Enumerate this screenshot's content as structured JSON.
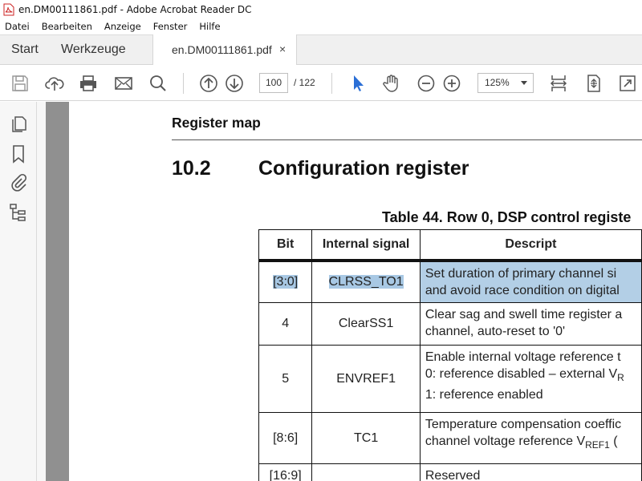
{
  "window": {
    "title": "en.DM00111861.pdf - Adobe Acrobat Reader DC"
  },
  "menu": [
    "Datei",
    "Bearbeiten",
    "Anzeige",
    "Fenster",
    "Hilfe"
  ],
  "tabs": {
    "start": "Start",
    "tools": "Werkzeuge",
    "document": "en.DM00111861.pdf",
    "close": "×"
  },
  "toolbar": {
    "page_current": "100",
    "page_total": "/  122",
    "zoom": "125%",
    "icons": [
      "save-icon",
      "upload-icon",
      "print-icon",
      "mail-icon",
      "search-icon",
      "page-up-icon",
      "page-down-icon",
      "select-cursor-icon",
      "hand-tool-icon",
      "zoom-out-icon",
      "zoom-in-icon",
      "fit-width-icon",
      "fit-page-icon",
      "fullscreen-icon"
    ]
  },
  "left_pane": {
    "icons": [
      "pages-icon",
      "bookmark-icon",
      "attachment-icon",
      "layers-icon"
    ]
  },
  "document": {
    "header": "Register map",
    "section_number": "10.2",
    "section_title": "Configuration register",
    "table_caption": "Table 44. Row 0, DSP control registe",
    "table": {
      "headers": [
        "Bit",
        "Internal signal",
        "Descript"
      ],
      "rows": [
        {
          "bit": "[3:0]",
          "signal": "CLRSS_TO1",
          "desc": [
            "Set duration of primary channel si",
            "and avoid race condition on digital"
          ],
          "highlighted": true
        },
        {
          "bit": "4",
          "signal": "ClearSS1",
          "desc": [
            "Clear sag and swell time register a",
            "channel, auto-reset to '0'"
          ],
          "highlighted": false
        },
        {
          "bit": "5",
          "signal": "ENVREF1",
          "desc": [
            "Enable internal voltage reference t",
            "0: reference disabled – external V",
            "1: reference enabled"
          ],
          "desc_subscript": "R",
          "highlighted": false
        },
        {
          "bit": "[8:6]",
          "signal": "TC1",
          "desc": [
            "Temperature compensation coeffic",
            "channel voltage reference V"
          ],
          "desc_subscript": "REF1",
          "desc_suffix": " (",
          "highlighted": false
        },
        {
          "bit": "[16:9]",
          "signal": "",
          "desc": [
            "Reserved"
          ],
          "highlighted": false
        }
      ]
    }
  },
  "colors": {
    "highlight": "#a8c8e4",
    "accent": "#2b6fd6",
    "scroll_strip": "#909090"
  }
}
